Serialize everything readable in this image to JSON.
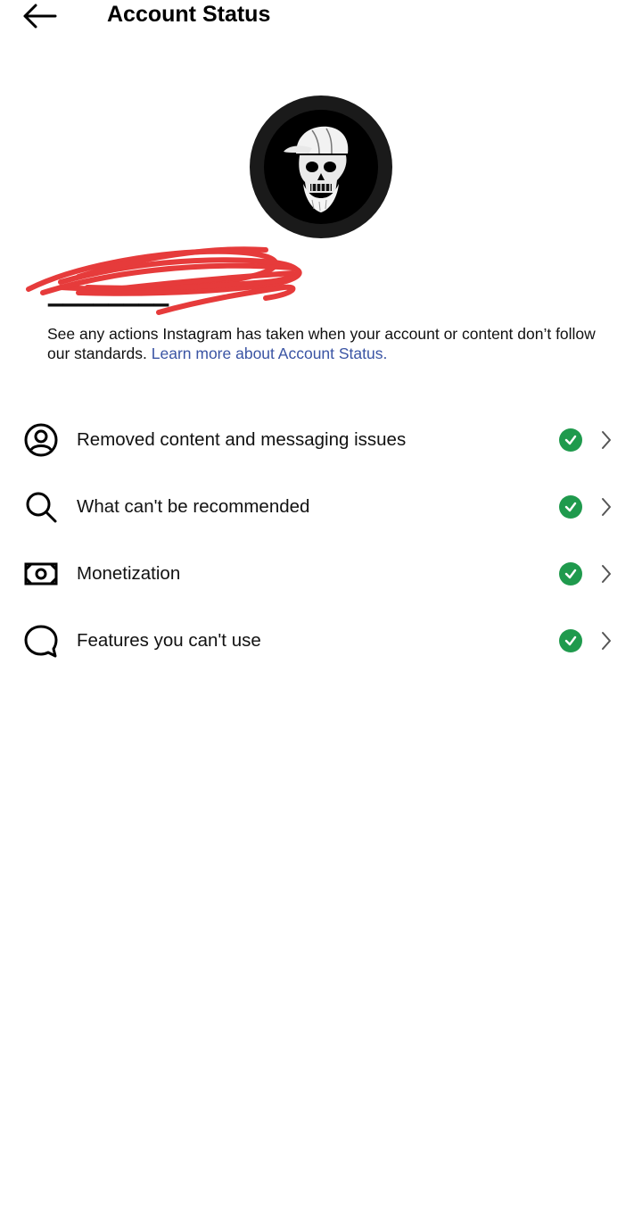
{
  "header": {
    "title": "Account Status",
    "back_icon": "arrow-left-icon"
  },
  "profile": {
    "avatar_icon": "skull-with-cap-avatar",
    "username_redacted": true,
    "redaction_color": "#e63b3b"
  },
  "intro": {
    "text": "See any actions Instagram has taken when your account or content don’t follow our standards.",
    "link": "Learn more about Account Status."
  },
  "items": [
    {
      "label": "Removed content and messaging issues",
      "icon": "person-circle-icon",
      "status_icon": "check-circle-icon"
    },
    {
      "label": "What can't be recommended",
      "icon": "search-icon",
      "status_icon": "check-circle-icon"
    },
    {
      "label": "Monetization",
      "icon": "money-icon",
      "status_icon": "check-circle-icon"
    },
    {
      "label": "Features you can't use",
      "icon": "speech-bubble-icon",
      "status_icon": "check-circle-icon"
    }
  ],
  "colors": {
    "status_ok": "#1f9a4d",
    "link": "#3a54a4"
  }
}
